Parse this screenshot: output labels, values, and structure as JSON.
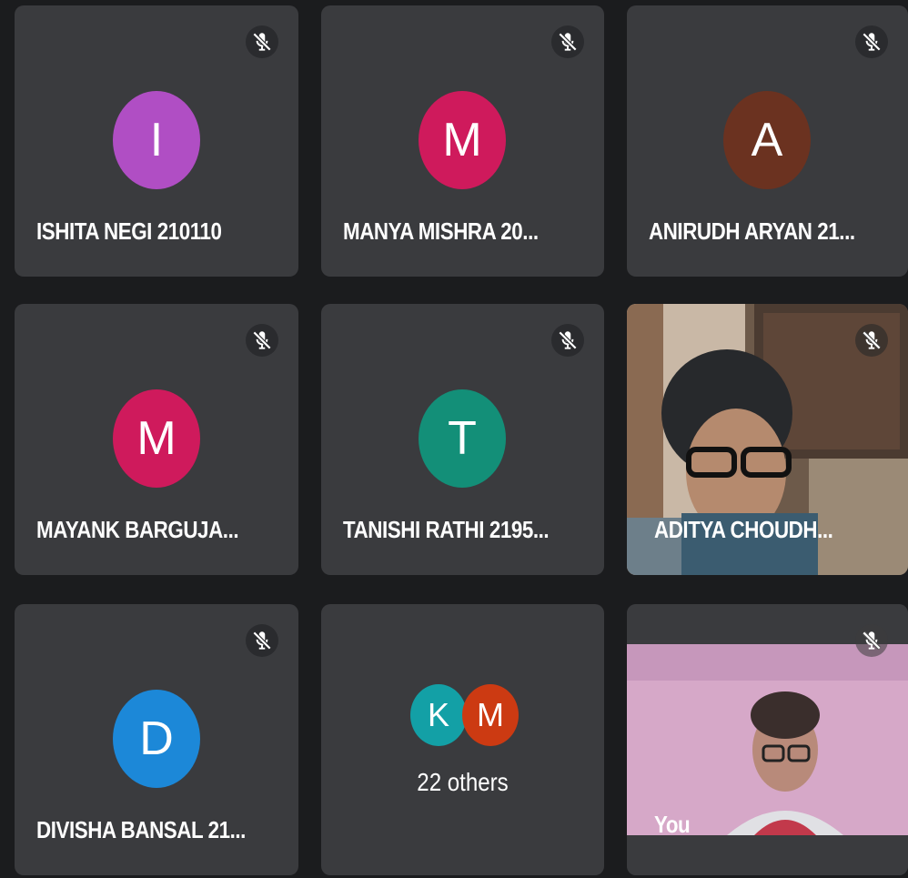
{
  "tiles": [
    {
      "name": "ISHITA NEGI 210110",
      "initial": "I",
      "color": "#b04ec4"
    },
    {
      "name": "MANYA MISHRA 20...",
      "initial": "M",
      "color": "#cf1a5c"
    },
    {
      "name": "ANIRUDH ARYAN 21...",
      "initial": "A",
      "color": "#6b3220"
    },
    {
      "name": "MAYANK BARGUJA...",
      "initial": "M",
      "color": "#cf1a5c"
    },
    {
      "name": "TANISHI RATHI 2195...",
      "initial": "T",
      "color": "#138f78"
    },
    {
      "name": "ADITYA CHOUDH..."
    },
    {
      "name": "DIVISHA BANSAL 21...",
      "initial": "D",
      "color": "#1c88d8"
    },
    {
      "others_label": "22 others",
      "initials": [
        "K",
        "M"
      ],
      "colors": [
        "#13a0a6",
        "#cc3a12"
      ]
    },
    {
      "name": "You"
    }
  ],
  "icons": {
    "mute": "mic-off-icon"
  }
}
